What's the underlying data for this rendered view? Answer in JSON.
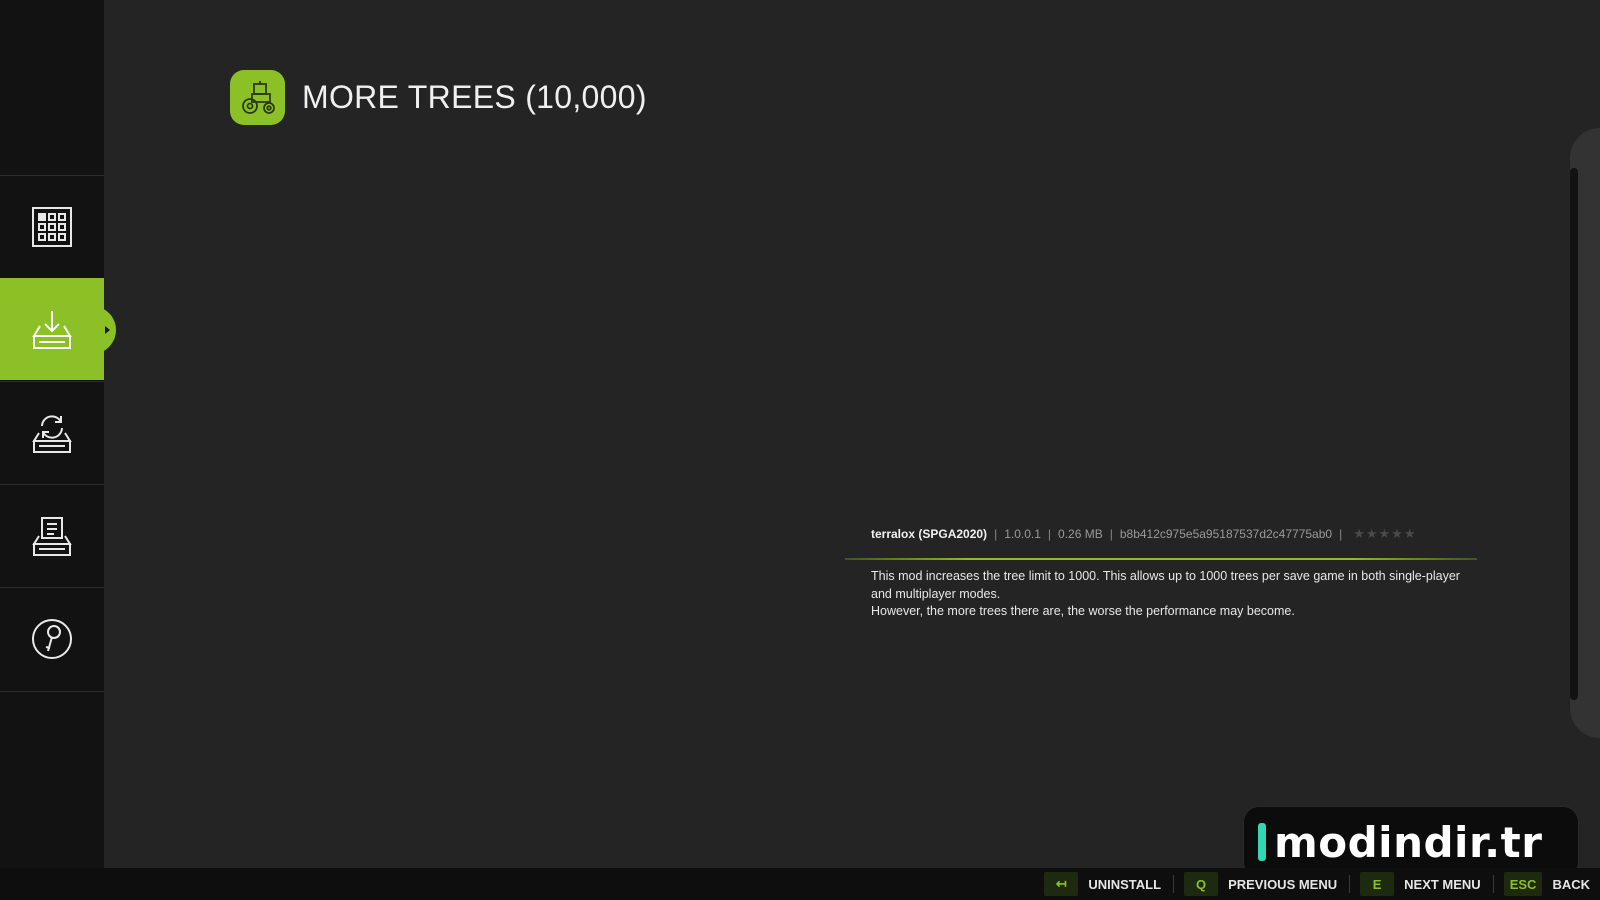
{
  "sidebar": {
    "items": [
      {
        "icon": "grid-icon"
      },
      {
        "icon": "download-icon",
        "active": true
      },
      {
        "icon": "update-icon"
      },
      {
        "icon": "install-box-icon"
      },
      {
        "icon": "wrench-icon"
      }
    ]
  },
  "header": {
    "icon": "tractor-icon",
    "title": "MORE TREES (10,000)"
  },
  "mod": {
    "author": "terralox (SPGA2020)",
    "version": "1.0.0.1",
    "size": "0.26 MB",
    "hash": "b8b412c975e5a95187537d2c47775ab0",
    "rating_filled": 0,
    "rating_max": 5,
    "description_line1": "This mod increases the tree limit to 1000. This allows up to 1000 trees per save game in both single-player and multiplayer modes.",
    "description_line2": "However, the more trees there are, the worse the performance may become."
  },
  "watermark": {
    "text": "modindir.tr"
  },
  "footer": {
    "actions": [
      {
        "key": "↤",
        "label": "UNINSTALL"
      },
      {
        "key": "Q",
        "label": "PREVIOUS MENU"
      },
      {
        "key": "E",
        "label": "NEXT MENU"
      },
      {
        "key": "ESC",
        "label": "BACK"
      }
    ]
  },
  "colors": {
    "accent": "#8cc027",
    "background": "#242424",
    "sidebar": "#121212"
  }
}
